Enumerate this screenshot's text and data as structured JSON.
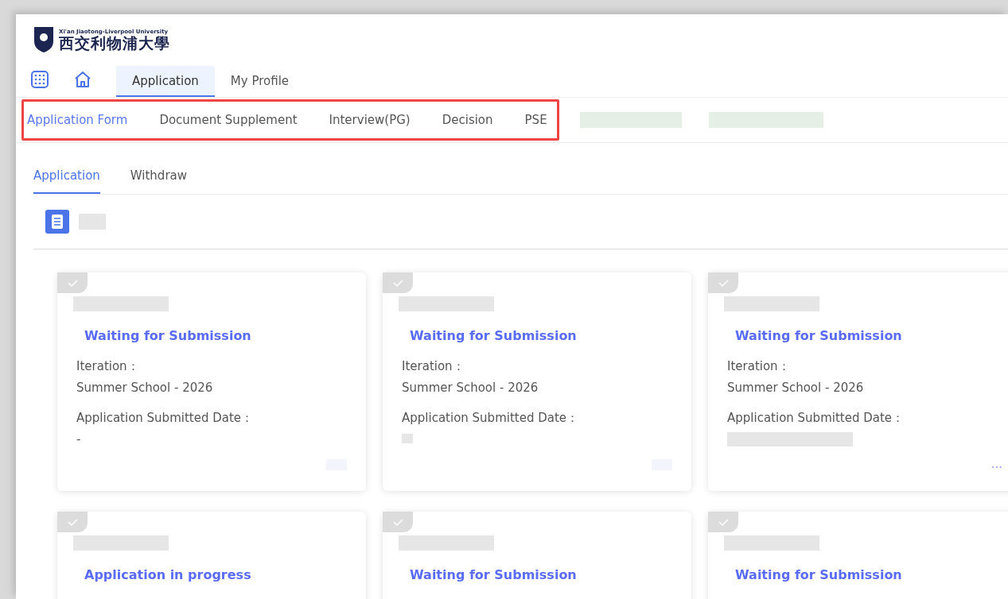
{
  "logo": {
    "english": "Xi'an Jiaotong-Liverpool University",
    "chinese": "西交利物浦大學"
  },
  "main_nav": [
    {
      "label": "Application",
      "selected": true
    },
    {
      "label": "My Profile",
      "selected": false
    }
  ],
  "sub_nav": [
    {
      "label": "Application Form",
      "selected": true
    },
    {
      "label": "Document Supplement",
      "selected": false
    },
    {
      "label": "Interview(PG)",
      "selected": false
    },
    {
      "label": "Decision",
      "selected": false
    },
    {
      "label": "PSE",
      "selected": false
    }
  ],
  "section_tabs": [
    {
      "label": "Application",
      "selected": true
    },
    {
      "label": "Withdraw",
      "selected": false
    }
  ],
  "cards": [
    {
      "status": "Waiting for Submission",
      "iteration_label": "Iteration：",
      "iteration": "Summer School - 2026",
      "date_label": "Application Submitted Date：",
      "date": "-"
    },
    {
      "status": "Waiting for Submission",
      "iteration_label": "Iteration：",
      "iteration": "Summer School - 2026",
      "date_label": "Application Submitted Date："
    },
    {
      "status": "Waiting for Submission",
      "iteration_label": "Iteration：",
      "iteration": "Summer School - 2026",
      "date_label": "Application Submitted Date：",
      "more": "···"
    },
    {
      "status": "Application in progress"
    },
    {
      "status": "Waiting for Submission"
    },
    {
      "status": "Waiting for Submission"
    }
  ]
}
